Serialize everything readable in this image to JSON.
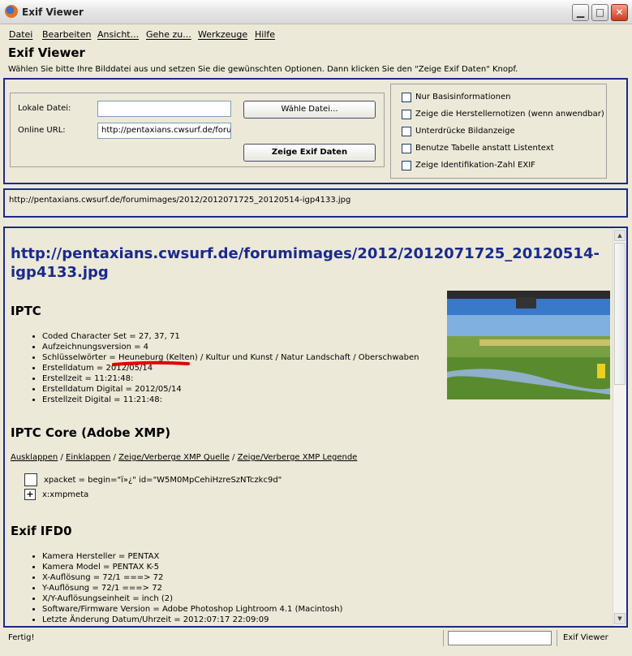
{
  "window": {
    "title": "Exif Viewer"
  },
  "menu": [
    "Datei",
    "Bearbeiten",
    "Ansicht...",
    "Gehe zu...",
    "Werkzeuge",
    "Hilfe"
  ],
  "app_title": "Exif Viewer",
  "instructions": "Wählen Sie bitte Ihre Bilddatei aus und setzen Sie die gewünschten Optionen. Dann klicken Sie den \"Zeige Exif Daten\" Knopf.",
  "form": {
    "local_label": "Lokale Datei:",
    "local_value": "",
    "url_label": "Online URL:",
    "url_value": "http://pentaxians.cwsurf.de/forumimages/2012/2012071725_20120514-igp4133.jpg",
    "choose_button": "Wähle Datei...",
    "show_button": "Zeige Exif Daten"
  },
  "options": [
    {
      "label": "Nur Basisinformationen",
      "checked": false
    },
    {
      "label": "Zeige die Herstellernotizen (wenn anwendbar)",
      "checked": false
    },
    {
      "label": "Unterdrücke Bildanzeige",
      "checked": false
    },
    {
      "label": "Benutze Tabelle anstatt Listentext",
      "checked": false
    },
    {
      "label": "Zeige Identifikation-Zahl EXIF",
      "checked": false
    }
  ],
  "url_bar": "http://pentaxians.cwsurf.de/forumimages/2012/2012071725_20120514-igp4133.jpg",
  "content": {
    "heading": "http://pentaxians.cwsurf.de/forumimages/2012/2012071725_20120514-igp4133.jpg",
    "iptc_title": "IPTC",
    "iptc": [
      "Coded Character Set = 27, 37, 71",
      "Aufzeichnungsversion = 4",
      "Schlüsselwörter = Heuneburg (Kelten) / Kultur und Kunst / Natur Landschaft / Oberschwaben",
      "Erstelldatum = 2012/05/14",
      "Erstellzeit = 11:21:48:",
      "Erstelldatum Digital = 2012/05/14",
      "Erstellzeit Digital = 11:21:48:"
    ],
    "xmp_title": "IPTC Core (Adobe XMP)",
    "xmp_links": [
      "Ausklappen",
      "Einklappen",
      "Zeige/Verberge XMP Quelle",
      "Zeige/Verberge XMP Legende"
    ],
    "xmp_rows": [
      {
        "toggle": "",
        "text": "xpacket = begin=\"ï»¿\" id=\"W5M0MpCehiHzreSzNTczkc9d\""
      },
      {
        "toggle": "+",
        "text": "x:xmpmeta"
      }
    ],
    "exif_title": "Exif IFD0",
    "exif": [
      "Kamera Hersteller = PENTAX",
      "Kamera Model = PENTAX K-5",
      "X-Auflösung = 72/1 ===> 72",
      "Y-Auflösung = 72/1 ===> 72",
      "X/Y-Auflösungseinheit = inch (2)",
      "Software/Firmware Version = Adobe Photoshop Lightroom 4.1 (Macintosh)",
      "Letzte Änderung Datum/Uhrzeit = 2012:07:17 22:09:09"
    ]
  },
  "status": {
    "left": "Fertig!",
    "right": "Exif Viewer"
  },
  "colors": {
    "accent_border": "#1a2a8a",
    "heading_link": "#1a2a8a",
    "highlight_underline": "#e00000"
  }
}
